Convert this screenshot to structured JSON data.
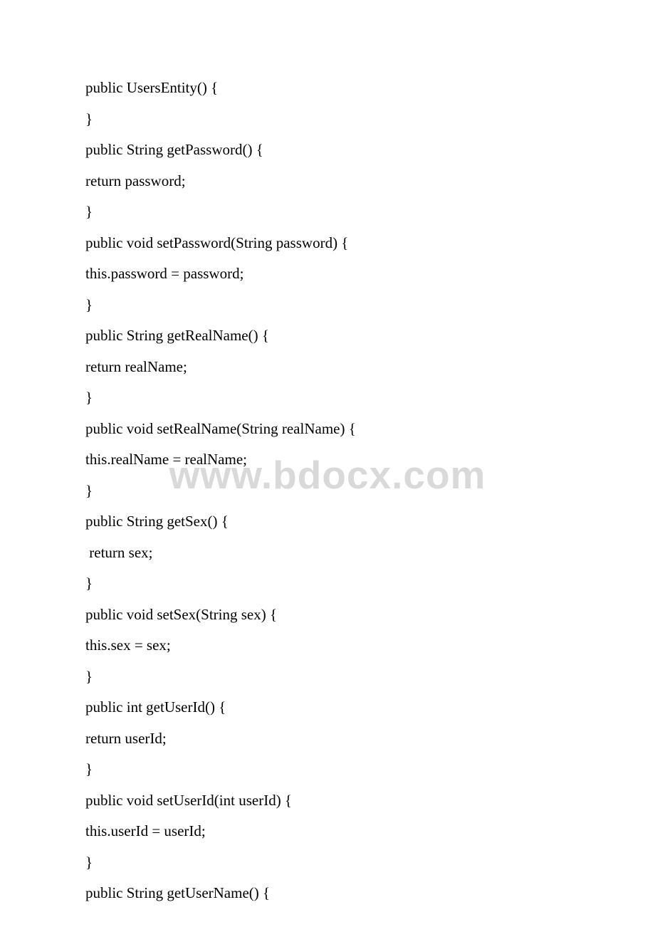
{
  "watermark": "www.bdocx.com",
  "code": {
    "lines": [
      "public UsersEntity() {",
      "}",
      "public String getPassword() {",
      "return password;",
      "}",
      "public void setPassword(String password) {",
      "this.password = password;",
      "}",
      "public String getRealName() {",
      "return realName;",
      "}",
      "public void setRealName(String realName) {",
      "this.realName = realName;",
      "}",
      "public String getSex() {",
      " return sex;",
      "}",
      "public void setSex(String sex) {",
      "this.sex = sex;",
      "}",
      "public int getUserId() {",
      "return userId;",
      "}",
      "public void setUserId(int userId) {",
      "this.userId = userId;",
      "}",
      "public String getUserName() {"
    ]
  }
}
